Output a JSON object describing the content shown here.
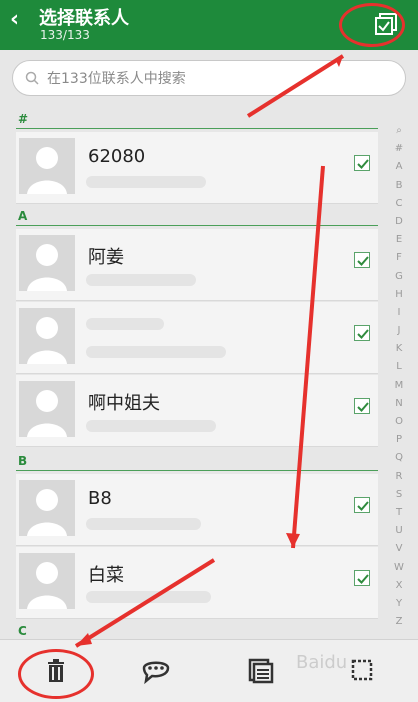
{
  "header": {
    "title": "选择联系人",
    "subtitle": "133/133"
  },
  "search": {
    "placeholder": "在133位联系人中搜索"
  },
  "sections": [
    {
      "label": "#"
    },
    {
      "label": "A"
    },
    {
      "label": "B"
    },
    {
      "label": "C"
    }
  ],
  "contacts": [
    {
      "name": "62080",
      "checked": true
    },
    {
      "name": "阿姜",
      "checked": true
    },
    {
      "name": "",
      "checked": true
    },
    {
      "name": "啊中姐夫",
      "checked": true
    },
    {
      "name": "B8",
      "checked": true
    },
    {
      "name": "白菜",
      "checked": true
    }
  ],
  "index": [
    "Q",
    "#",
    "A",
    "B",
    "C",
    "D",
    "E",
    "F",
    "G",
    "H",
    "I",
    "J",
    "K",
    "L",
    "M",
    "N",
    "O",
    "P",
    "Q",
    "R",
    "S",
    "T",
    "U",
    "V",
    "W",
    "X",
    "Y",
    "Z"
  ],
  "bottom_bar": {
    "icons": [
      "trash-icon",
      "message-icon",
      "copy-icon",
      "select-box-icon"
    ]
  },
  "watermark": "Baidu"
}
